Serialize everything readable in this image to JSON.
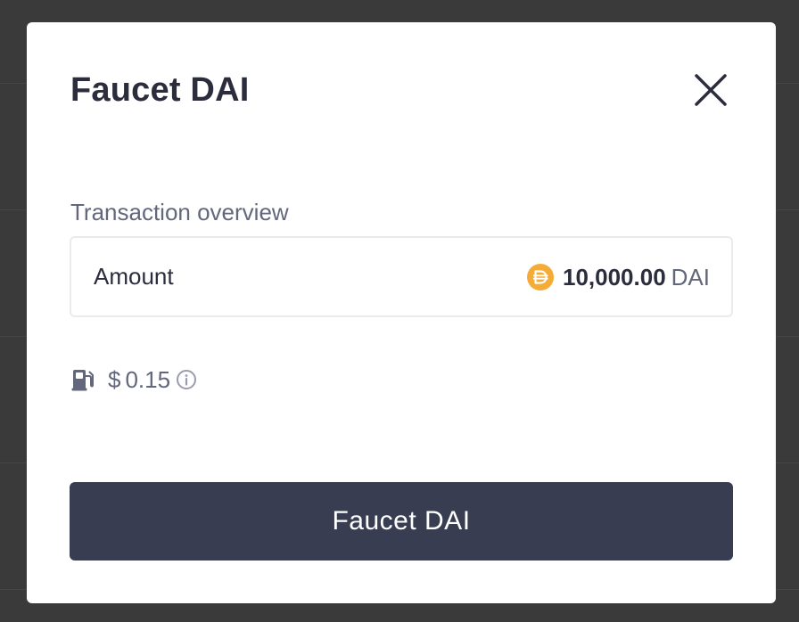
{
  "modal": {
    "title": "Faucet DAI",
    "section_label": "Transaction overview",
    "amount": {
      "label": "Amount",
      "value": "10,000.00",
      "symbol": "DAI",
      "token_icon": "dai-token-icon",
      "token_color": "#F5AC37"
    },
    "gas": {
      "icon": "gas-pump-icon",
      "currency": "$",
      "value": "0.15",
      "info_icon": "info-icon"
    },
    "action_button": {
      "label": "Faucet DAI",
      "color": "#383D51"
    },
    "close_icon": "close-icon"
  }
}
